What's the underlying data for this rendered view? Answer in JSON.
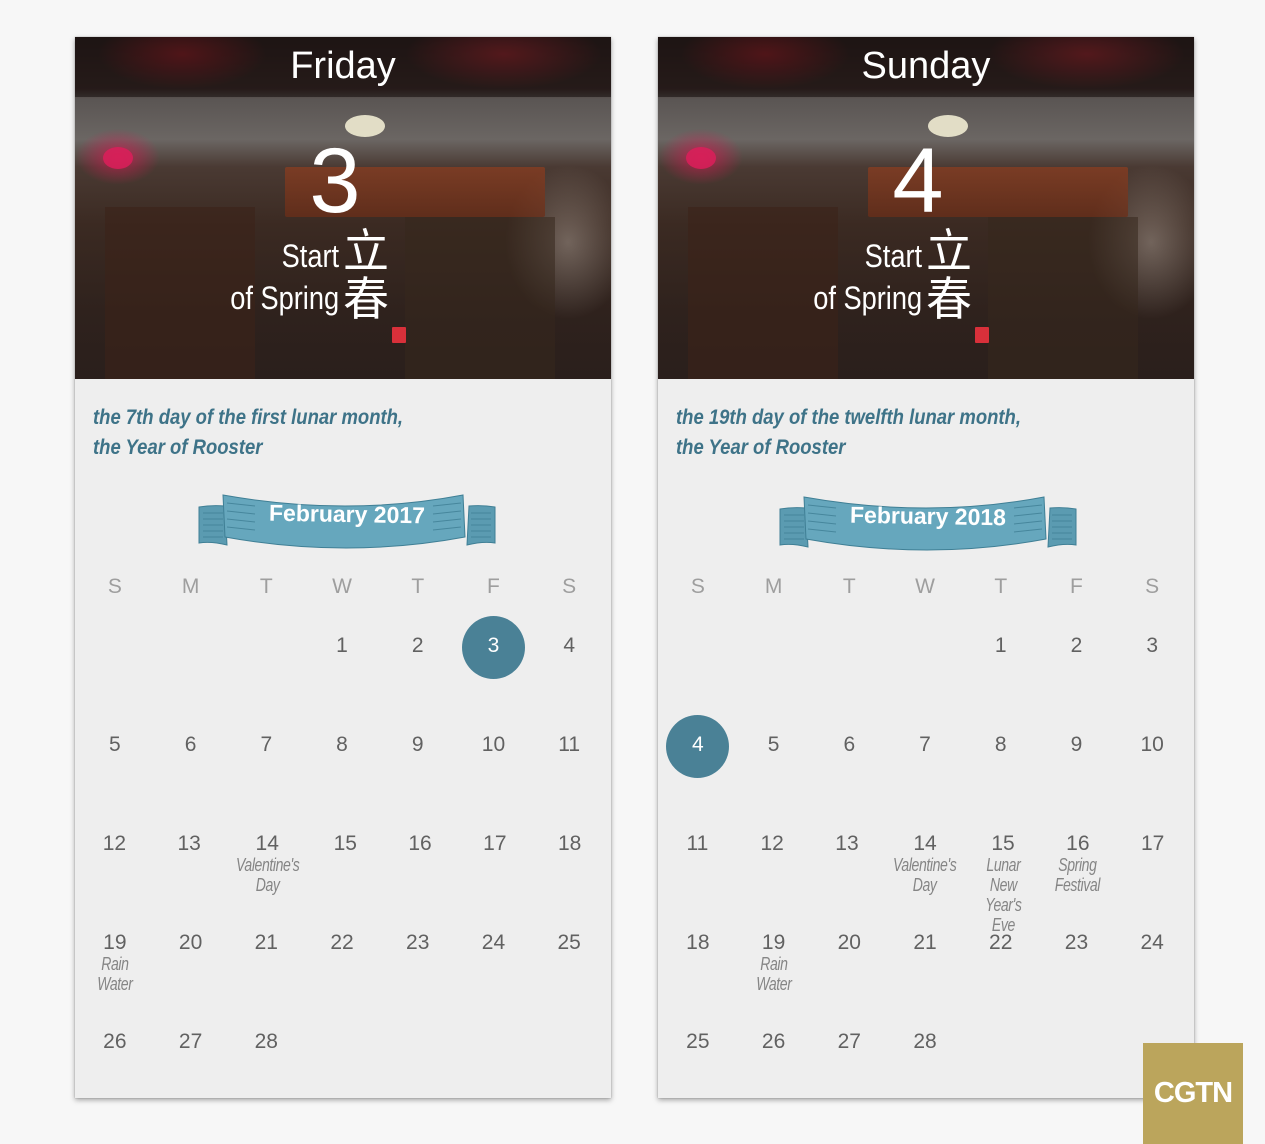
{
  "colors": {
    "accent": "#4a8196",
    "lunar_text": "#3e7388",
    "ribbon": "#5f9fb5",
    "ribbon_dark": "#4a8aa0",
    "day_number": "#616161",
    "weekday": "#9e9e9e",
    "note": "#858585",
    "card_bg": "#eeeeee",
    "logo_bg": "#bba55c"
  },
  "cards": [
    {
      "day_name": "Friday",
      "date_number": "3",
      "solar_term_en_line1": "Start",
      "solar_term_en_line2": "of Spring",
      "solar_term_zh_line1": "立",
      "solar_term_zh_line2": "春",
      "lunar_line1": "the 7th day of the first lunar month,",
      "lunar_line2": "the Year of Rooster",
      "month_label": "February 2017",
      "weekdays": [
        "S",
        "M",
        "T",
        "W",
        "T",
        "F",
        "S"
      ],
      "selected_day": "3",
      "weeks": [
        [
          {
            "d": ""
          },
          {
            "d": ""
          },
          {
            "d": ""
          },
          {
            "d": "1"
          },
          {
            "d": "2"
          },
          {
            "d": "3",
            "sel": true
          },
          {
            "d": "4"
          }
        ],
        [
          {
            "d": "5"
          },
          {
            "d": "6"
          },
          {
            "d": "7"
          },
          {
            "d": "8"
          },
          {
            "d": "9"
          },
          {
            "d": "10"
          },
          {
            "d": "11"
          }
        ],
        [
          {
            "d": "12"
          },
          {
            "d": "13"
          },
          {
            "d": "14",
            "note": "Valentine's\nDay"
          },
          {
            "d": "15"
          },
          {
            "d": "16"
          },
          {
            "d": "17"
          },
          {
            "d": "18"
          }
        ],
        [
          {
            "d": "19",
            "note": "Rain\nWater"
          },
          {
            "d": "20"
          },
          {
            "d": "21"
          },
          {
            "d": "22"
          },
          {
            "d": "23"
          },
          {
            "d": "24"
          },
          {
            "d": "25"
          }
        ],
        [
          {
            "d": "26"
          },
          {
            "d": "27"
          },
          {
            "d": "28"
          },
          {
            "d": ""
          },
          {
            "d": ""
          },
          {
            "d": ""
          },
          {
            "d": ""
          }
        ]
      ]
    },
    {
      "day_name": "Sunday",
      "date_number": "4",
      "solar_term_en_line1": "Start",
      "solar_term_en_line2": "of Spring",
      "solar_term_zh_line1": "立",
      "solar_term_zh_line2": "春",
      "lunar_line1": "the 19th day of the twelfth lunar month,",
      "lunar_line2": "the Year of Rooster",
      "month_label": "February 2018",
      "weekdays": [
        "S",
        "M",
        "T",
        "W",
        "T",
        "F",
        "S"
      ],
      "selected_day": "4",
      "weeks": [
        [
          {
            "d": ""
          },
          {
            "d": ""
          },
          {
            "d": ""
          },
          {
            "d": ""
          },
          {
            "d": "1"
          },
          {
            "d": "2"
          },
          {
            "d": "3"
          }
        ],
        [
          {
            "d": "4",
            "sel": true
          },
          {
            "d": "5"
          },
          {
            "d": "6"
          },
          {
            "d": "7"
          },
          {
            "d": "8"
          },
          {
            "d": "9"
          },
          {
            "d": "10"
          }
        ],
        [
          {
            "d": "11"
          },
          {
            "d": "12"
          },
          {
            "d": "13"
          },
          {
            "d": "14",
            "note": "Valentine's\nDay"
          },
          {
            "d": "15",
            "note": "Lunar\nNew Year's\nEve"
          },
          {
            "d": "16",
            "note": "Spring\nFestival"
          },
          {
            "d": "17"
          }
        ],
        [
          {
            "d": "18"
          },
          {
            "d": "19",
            "note": "Rain\nWater"
          },
          {
            "d": "20"
          },
          {
            "d": "21"
          },
          {
            "d": "22"
          },
          {
            "d": "23"
          },
          {
            "d": "24"
          }
        ],
        [
          {
            "d": "25"
          },
          {
            "d": "26"
          },
          {
            "d": "27"
          },
          {
            "d": "28"
          },
          {
            "d": ""
          },
          {
            "d": ""
          },
          {
            "d": ""
          }
        ]
      ]
    }
  ],
  "logo": {
    "text": "CGTN"
  }
}
